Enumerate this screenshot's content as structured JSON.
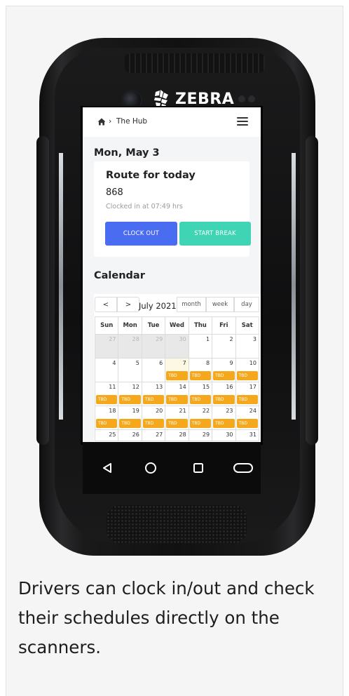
{
  "device": {
    "brand": "ZEBRA"
  },
  "app": {
    "breadcrumb": {
      "label": "The Hub"
    },
    "date_heading": "Mon, May 3",
    "route_card": {
      "title": "Route for today",
      "number": "868",
      "status": "Clocked in at 07:49 hrs",
      "clock_out_label": "CLOCK OUT",
      "start_break_label": "START BREAK",
      "clock_out_color": "#4a6cf0",
      "start_break_color": "#3fd4b4"
    },
    "calendar": {
      "heading": "Calendar",
      "prev_label": "<",
      "next_label": ">",
      "month_label": "July 2021",
      "views": [
        "month",
        "week",
        "day"
      ],
      "weekdays": [
        "Sun",
        "Mon",
        "Tue",
        "Wed",
        "Thu",
        "Fri",
        "Sat"
      ],
      "event_color": "#f5a81c",
      "weeks": [
        [
          {
            "day": "27",
            "other": true
          },
          {
            "day": "28",
            "other": true
          },
          {
            "day": "29",
            "other": true
          },
          {
            "day": "30",
            "other": true
          },
          {
            "day": "1"
          },
          {
            "day": "2"
          },
          {
            "day": "3"
          }
        ],
        [
          {
            "day": "4"
          },
          {
            "day": "5"
          },
          {
            "day": "6"
          },
          {
            "day": "7",
            "today": true,
            "event": "TBD"
          },
          {
            "day": "8",
            "event": "TBD"
          },
          {
            "day": "9",
            "event": "TBD"
          },
          {
            "day": "10",
            "event": "TBD"
          }
        ],
        [
          {
            "day": "11",
            "event": "TBD"
          },
          {
            "day": "12",
            "event": "TBD"
          },
          {
            "day": "13",
            "event": "TBD"
          },
          {
            "day": "14",
            "event": "TBD"
          },
          {
            "day": "15",
            "event": "TBD"
          },
          {
            "day": "16",
            "event": "TBD"
          },
          {
            "day": "17",
            "event": "TBD"
          }
        ],
        [
          {
            "day": "18",
            "event": "TBD"
          },
          {
            "day": "19",
            "event": "TBD"
          },
          {
            "day": "20",
            "event": "TBD"
          },
          {
            "day": "21",
            "event": "TBD"
          },
          {
            "day": "22",
            "event": "TBD"
          },
          {
            "day": "23",
            "event": "TBD"
          },
          {
            "day": "24",
            "event": "TBD"
          }
        ],
        [
          {
            "day": "25"
          },
          {
            "day": "26"
          },
          {
            "day": "27"
          },
          {
            "day": "28"
          },
          {
            "day": "29"
          },
          {
            "day": "30"
          },
          {
            "day": "31"
          }
        ]
      ]
    }
  },
  "icons": {
    "home": "home-icon",
    "menu": "hamburger-menu-icon",
    "back": "back-triangle-icon",
    "nav_home": "circle-home-icon",
    "recent": "square-recent-apps-icon",
    "assistant": "pill-icon"
  },
  "caption": "Drivers can clock in/out and check their schedules directly on the scanners."
}
